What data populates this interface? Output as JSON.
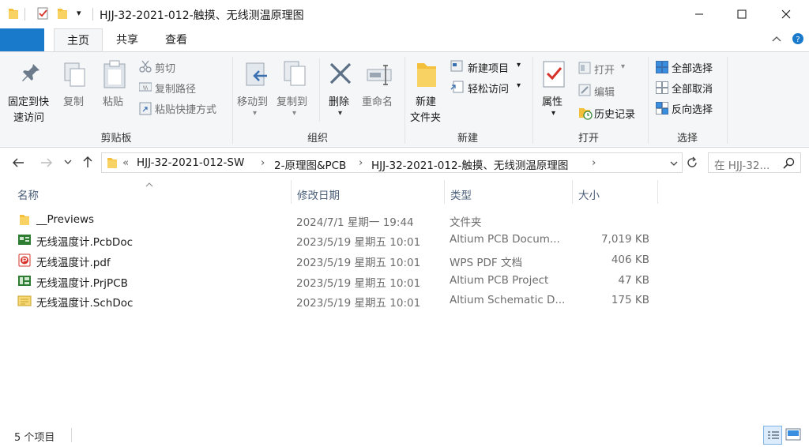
{
  "window": {
    "title": "HJJ-32-2021-012-触摸、无线测温原理图"
  },
  "tabs": [
    {
      "label": "主页",
      "active": true
    },
    {
      "label": "共享",
      "active": false
    },
    {
      "label": "查看",
      "active": false
    }
  ],
  "ribbon": {
    "clipboard": {
      "pin_label_1": "固定到快",
      "pin_label_2": "速访问",
      "copy_label": "复制",
      "paste_label": "粘贴",
      "cut_label": "剪切",
      "copy_path_label": "复制路径",
      "paste_shortcut_label": "粘贴快捷方式",
      "group_label": "剪贴板"
    },
    "organize": {
      "move_label": "移动到",
      "copy_to_label": "复制到",
      "delete_label": "删除",
      "rename_label": "重命名",
      "group_label": "组织"
    },
    "new": {
      "new_folder_label_1": "新建",
      "new_folder_label_2": "文件夹",
      "new_item_label": "新建项目",
      "easy_access_label": "轻松访问",
      "group_label": "新建"
    },
    "open": {
      "properties_label": "属性",
      "open_label": "打开",
      "edit_label": "编辑",
      "history_label": "历史记录",
      "group_label": "打开"
    },
    "select": {
      "select_all_label": "全部选择",
      "select_none_label": "全部取消",
      "invert_label": "反向选择",
      "group_label": "选择"
    }
  },
  "address": {
    "overflow": "«",
    "crumbs": [
      "HJJ-32-2021-012-SW",
      "2-原理图&PCB",
      "HJJ-32-2021-012-触摸、无线测温原理图"
    ],
    "search_placeholder": "在 HJJ-32..."
  },
  "columns": {
    "name": "名称",
    "date": "修改日期",
    "type": "类型",
    "size": "大小"
  },
  "files": [
    {
      "name": "__Previews",
      "date": "2024/7/1 星期一 19:44",
      "type": "文件夹",
      "size": "",
      "icon": "folder-icon"
    },
    {
      "name": "无线温度计.PcbDoc",
      "date": "2023/5/19 星期五 10:01",
      "type": "Altium PCB Docum...",
      "size": "7,019 KB",
      "icon": "pcbdoc-icon"
    },
    {
      "name": "无线温度计.pdf",
      "date": "2023/5/19 星期五 10:01",
      "type": "WPS PDF 文档",
      "size": "406 KB",
      "icon": "pdf-icon"
    },
    {
      "name": "无线温度计.PrjPCB",
      "date": "2023/5/19 星期五 10:01",
      "type": "Altium PCB Project",
      "size": "47 KB",
      "icon": "prjpcb-icon"
    },
    {
      "name": "无线温度计.SchDoc",
      "date": "2023/5/19 星期五 10:01",
      "type": "Altium Schematic D...",
      "size": "175 KB",
      "icon": "schdoc-icon"
    }
  ],
  "status": {
    "count": "5 个项目"
  },
  "colors": {
    "accent": "#1979ca",
    "folder": "#f4c03c",
    "header_text": "#4c607a"
  }
}
